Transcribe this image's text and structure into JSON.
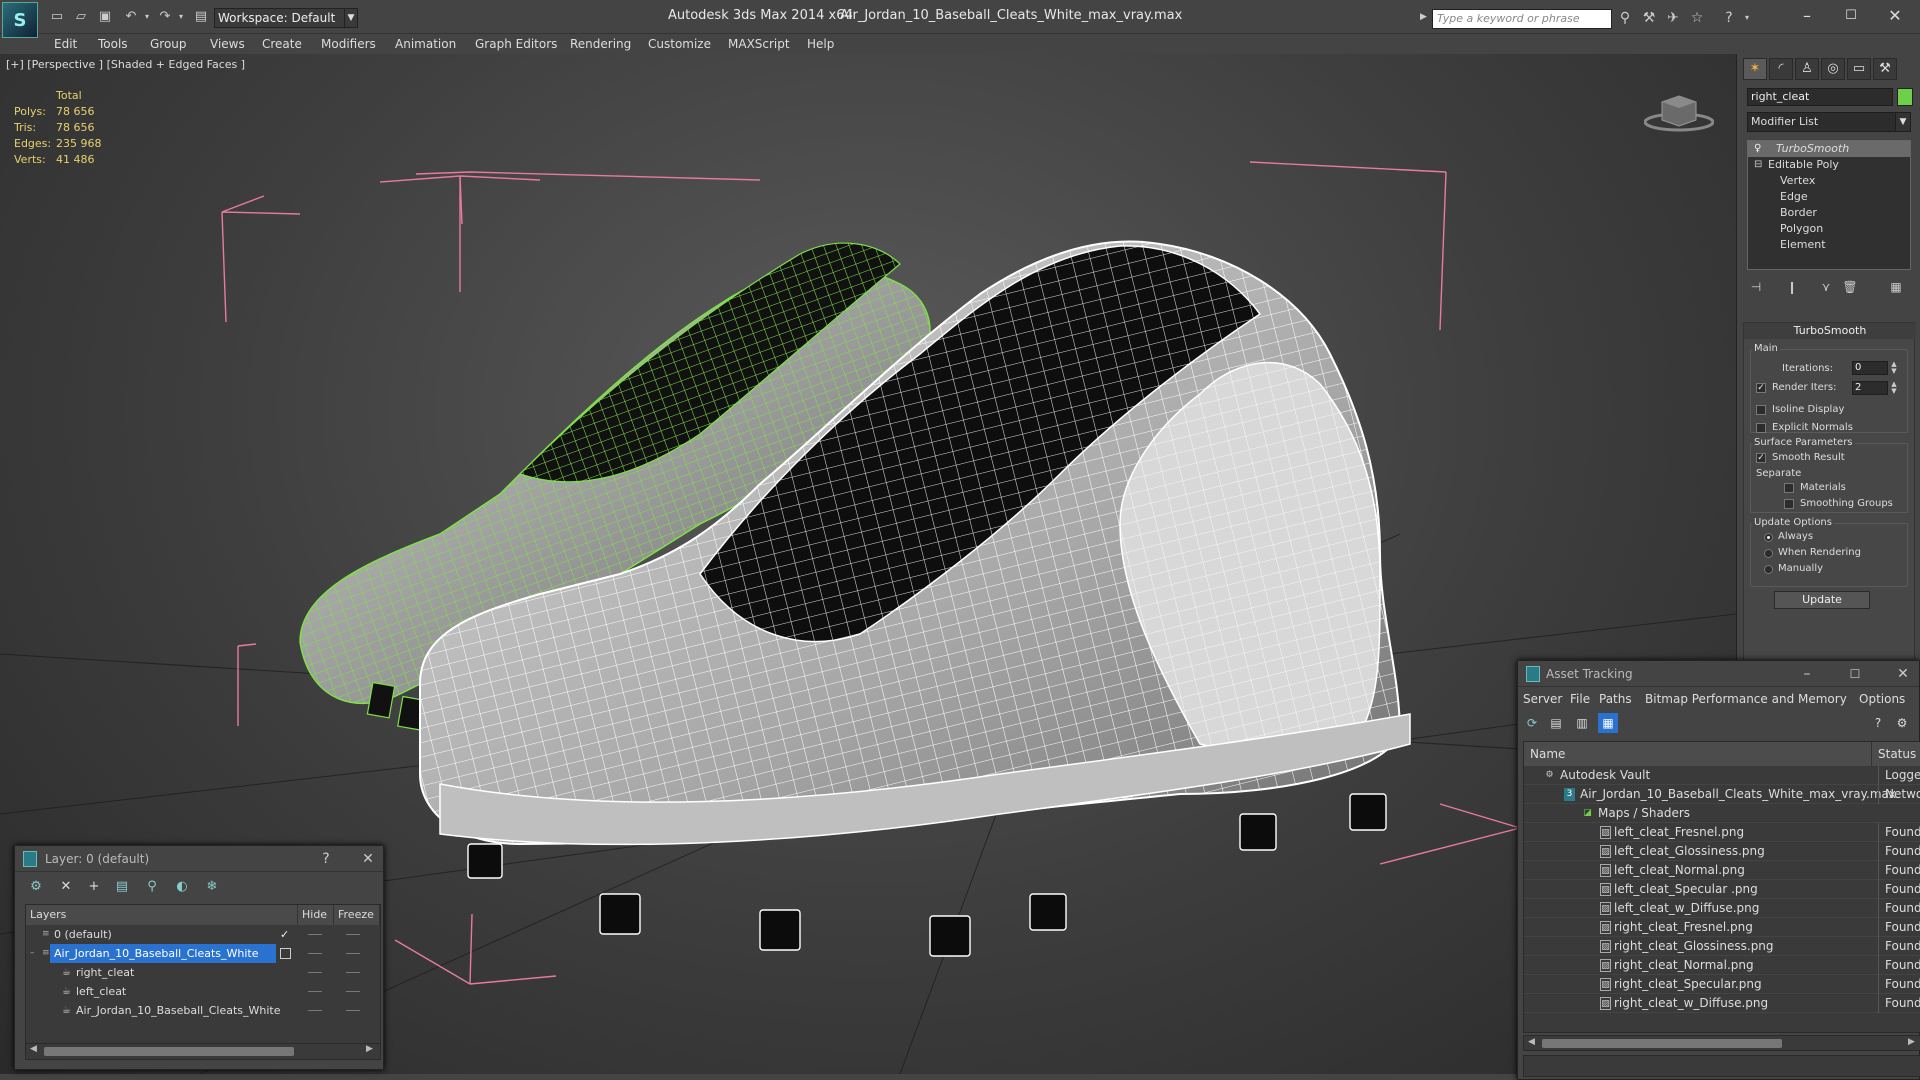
{
  "titlebar": {
    "app_title": "Autodesk 3ds Max  2014 x64",
    "file_title": "Air_Jordan_10_Baseball_Cleats_White_max_vray.max",
    "workspace": "Workspace: Default",
    "search_placeholder": "Type a keyword or phrase"
  },
  "menubar": [
    "Edit",
    "Tools",
    "Group",
    "Views",
    "Create",
    "Modifiers",
    "Animation",
    "Graph Editors",
    "Rendering",
    "Customize",
    "MAXScript",
    "Help"
  ],
  "viewport": {
    "label": "[+] [Perspective ] [Shaded + Edged Faces ]",
    "stats": {
      "header": "Total",
      "rows": [
        {
          "label": "Polys:",
          "value": "78 656"
        },
        {
          "label": "Tris:",
          "value": "78 656"
        },
        {
          "label": "Edges:",
          "value": "235 968"
        },
        {
          "label": "Verts:",
          "value": "41 486"
        }
      ]
    },
    "left_object_color": "#6ed048",
    "right_object_color": "#e8e8e8",
    "bbox_color": "#e87aa0"
  },
  "command_panel": {
    "object_name": "right_cleat",
    "object_color": "#6ed048",
    "modifier_list": "Modifier List",
    "stack": [
      "TurboSmooth",
      "Editable Poly",
      "Vertex",
      "Edge",
      "Border",
      "Polygon",
      "Element"
    ],
    "turbosmooth": {
      "title": "TurboSmooth",
      "main_label": "Main",
      "iterations_label": "Iterations:",
      "iterations_value": "0",
      "render_iters_label": "Render Iters:",
      "render_iters_value": "2",
      "isoline_label": "Isoline Display",
      "explicit_label": "Explicit Normals",
      "surface_label": "Surface Parameters",
      "smooth_label": "Smooth Result",
      "separate_label": "Separate",
      "materials_label": "Materials",
      "smoothing_label": "Smoothing Groups",
      "update_options_label": "Update Options",
      "always_label": "Always",
      "when_rendering_label": "When Rendering",
      "manually_label": "Manually",
      "update_button": "Update"
    }
  },
  "layer_panel": {
    "title": "Layer: 0 (default)",
    "help": "?",
    "columns": {
      "layers": "Layers",
      "hide": "Hide",
      "freeze": "Freeze"
    },
    "rows": [
      {
        "name": "0 (default)",
        "selected": false
      },
      {
        "name": "Air_Jordan_10_Baseball_Cleats_White",
        "selected": true
      },
      {
        "name": "right_cleat",
        "selected": false
      },
      {
        "name": "left_cleat",
        "selected": false
      },
      {
        "name": "Air_Jordan_10_Baseball_Cleats_White",
        "selected": false
      }
    ]
  },
  "asset_panel": {
    "title": "Asset Tracking",
    "menu": [
      "Server",
      "File",
      "Paths",
      "Bitmap Performance and Memory",
      "Options"
    ],
    "columns": {
      "name": "Name",
      "status": "Status"
    },
    "rows": [
      {
        "name": "Autodesk Vault",
        "status": "Logged Out"
      },
      {
        "name": "Air_Jordan_10_Baseball_Cleats_White_max_vray.max",
        "status": "Network"
      },
      {
        "name": "Maps / Shaders",
        "status": ""
      },
      {
        "name": "left_cleat_Fresnel.png",
        "status": "Found"
      },
      {
        "name": "left_cleat_Glossiness.png",
        "status": "Found"
      },
      {
        "name": "left_cleat_Normal.png",
        "status": "Found"
      },
      {
        "name": "left_cleat_Specular .png",
        "status": "Found"
      },
      {
        "name": "left_cleat_w_Diffuse.png",
        "status": "Found"
      },
      {
        "name": "right_cleat_Fresnel.png",
        "status": "Found"
      },
      {
        "name": "right_cleat_Glossiness.png",
        "status": "Found"
      },
      {
        "name": "right_cleat_Normal.png",
        "status": "Found"
      },
      {
        "name": "right_cleat_Specular.png",
        "status": "Found"
      },
      {
        "name": "right_cleat_w_Diffuse.png",
        "status": "Found"
      }
    ]
  }
}
